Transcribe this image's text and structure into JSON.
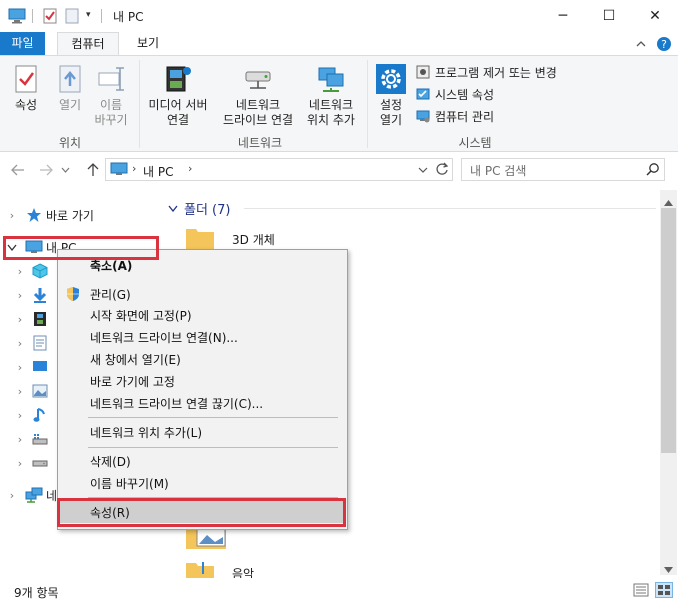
{
  "window": {
    "title": "내 PC",
    "minimize_glyph": "─",
    "maximize_glyph": "☐",
    "close_glyph": "✕"
  },
  "ribbon_tabs": {
    "file": "파일",
    "computer": "컴퓨터",
    "view": "보기"
  },
  "ribbon": {
    "location_group": {
      "label": "위치",
      "properties": "속성",
      "open": "열기",
      "rename_line1": "이름",
      "rename_line2": "바꾸기"
    },
    "network_group": {
      "label": "네트워크",
      "media_server_line1": "미디어 서버",
      "media_server_line2": "연결",
      "map_drive_line1": "네트워크",
      "map_drive_line2": "드라이브 연결",
      "add_location_line1": "네트워크",
      "add_location_line2": "위치 추가"
    },
    "system_group": {
      "label": "시스템",
      "settings_line1": "설정",
      "settings_line2": "열기",
      "uninstall": "프로그램 제거 또는 변경",
      "system_properties": "시스템 속성",
      "manage": "컴퓨터 관리"
    }
  },
  "address": {
    "path_segment": "내 PC",
    "search_placeholder": "내 PC 검색"
  },
  "nav_pane": {
    "quick_access": "바로 가기",
    "this_pc": "내 PC",
    "network_partial": "네"
  },
  "content": {
    "folders_header": "폴더 (7)",
    "items": [
      "3D 개체",
      "음악"
    ]
  },
  "context_menu": {
    "items": [
      "축소(A)",
      "관리(G)",
      "시작 화면에 고정(P)",
      "네트워크 드라이브 연결(N)...",
      "새 창에서 열기(E)",
      "바로 가기에 고정",
      "네트워크 드라이브 연결 끊기(C)...",
      "네트워크 위치 추가(L)",
      "삭제(D)",
      "이름 바꾸기(M)",
      "속성(R)"
    ]
  },
  "status": {
    "item_count": "9개 항목"
  },
  "colors": {
    "accent": "#1979ca",
    "highlight": "#d9333f",
    "folder": "#f3c55a"
  }
}
